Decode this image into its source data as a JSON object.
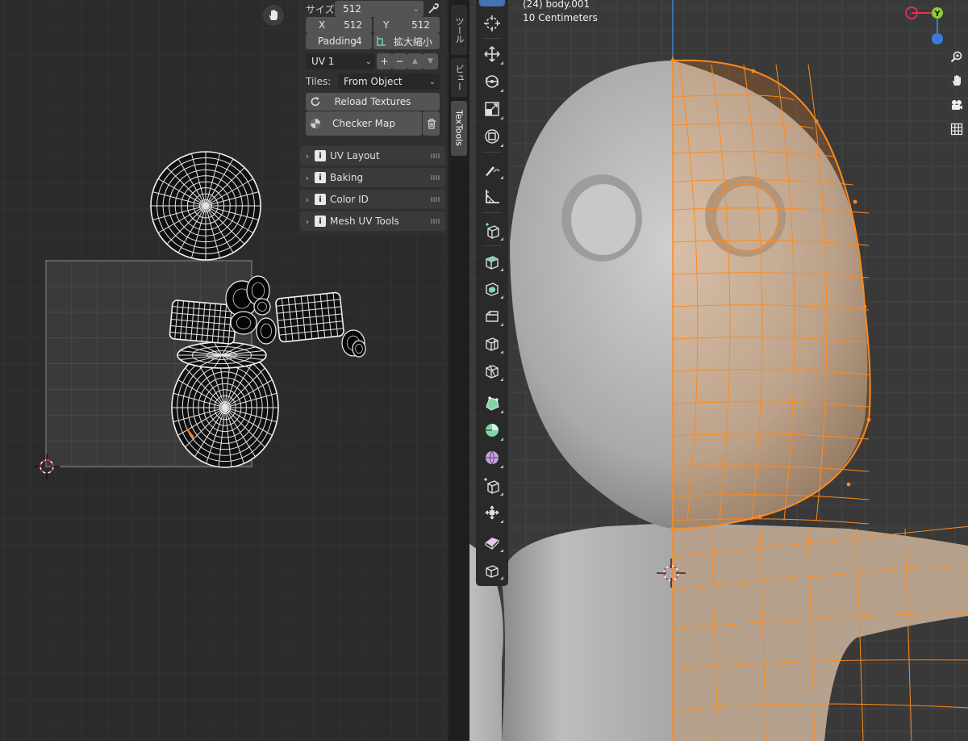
{
  "uv_panel": {
    "size_label": "サイズ:",
    "size_value": "512",
    "x_label": "X",
    "x_value": "512",
    "y_label": "Y",
    "y_value": "512",
    "padding_label": "Padding",
    "padding_value": "4",
    "scale_label": "拡大縮小",
    "uv_map": "UV 1",
    "tiles_label": "Tiles:",
    "tiles_value": "From Object",
    "reload_label": "Reload Textures",
    "checker_label": "Checker Map",
    "sections": [
      "UV Layout",
      "Baking",
      "Color ID",
      "Mesh UV Tools"
    ]
  },
  "tabs": [
    "ツール",
    "ビュー",
    "TexTools"
  ],
  "viewport": {
    "object_line": "(24) body.001",
    "scale_line": "10 Centimeters",
    "gizmo_y": "Y"
  },
  "colors": {
    "accent": "#4772b3",
    "selection": "#ff8a1c",
    "gizmo_x": "#e0344e",
    "gizmo_y": "#8bd02f",
    "gizmo_z": "#3b7bd6"
  },
  "icons": {
    "uv_hand": "hand-icon",
    "eyedropper": "eyedropper-icon",
    "reload": "reload-icon",
    "checker": "checker-icon",
    "trash": "trash-icon",
    "zoom": "zoom-icon",
    "camera": "camera-icon",
    "grid": "grid-icon"
  }
}
